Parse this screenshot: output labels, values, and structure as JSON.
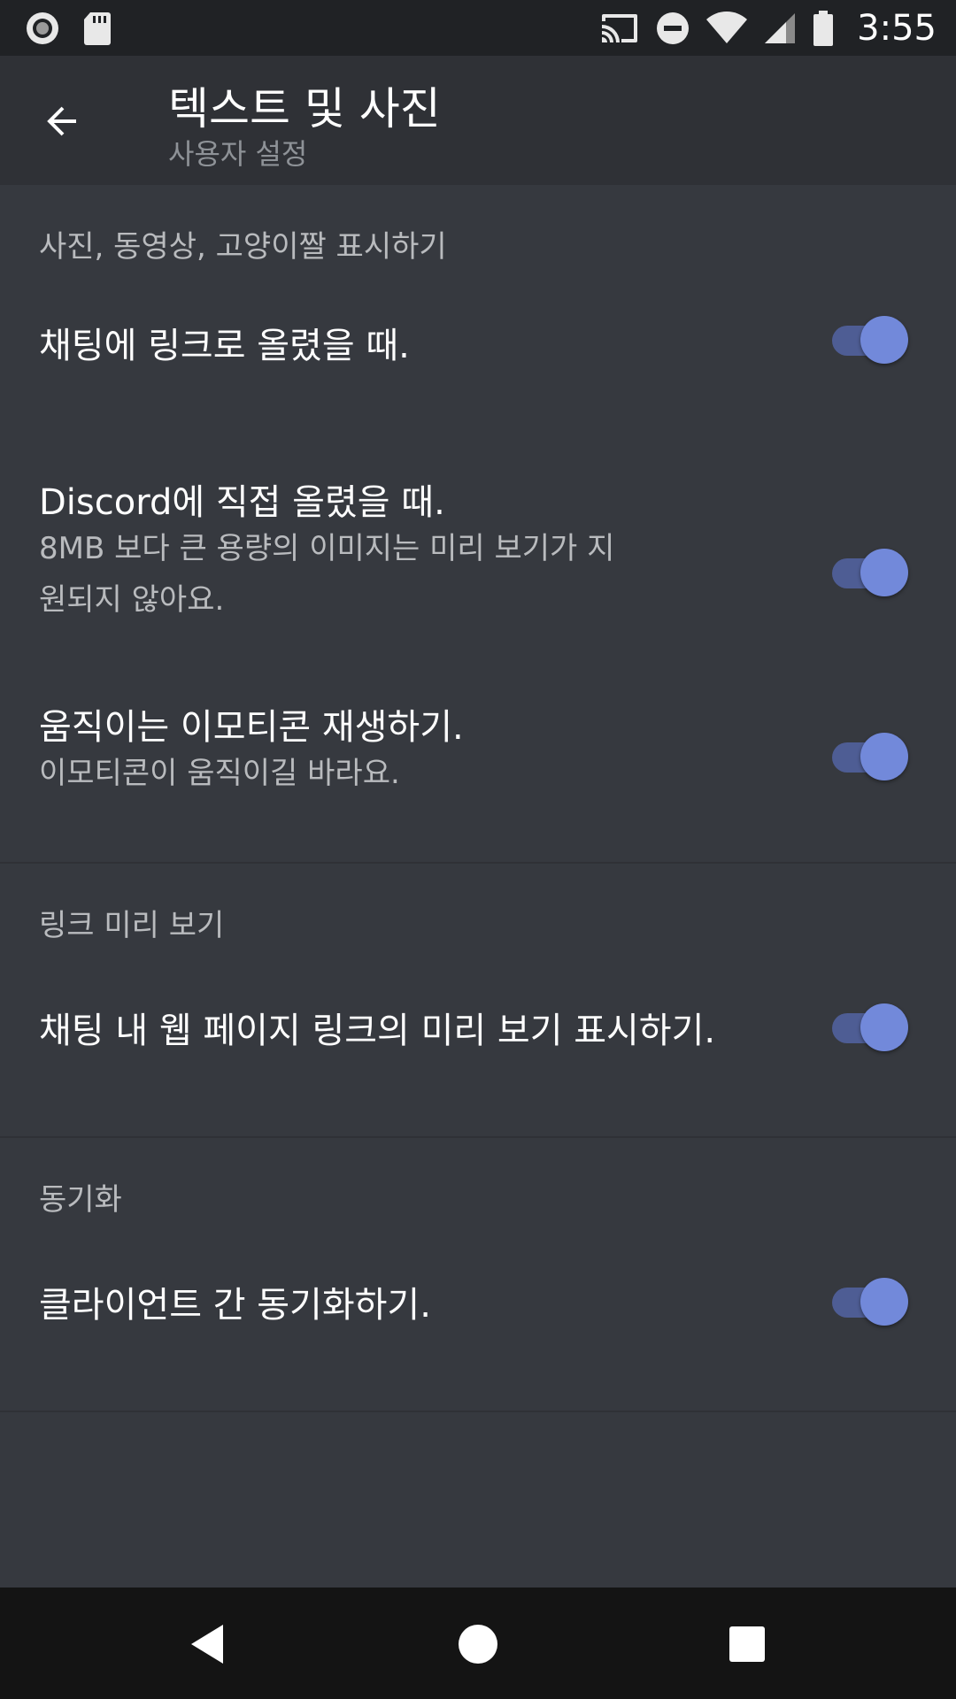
{
  "status_bar": {
    "time": "3:55",
    "icons": [
      "record-icon",
      "sd-card-icon",
      "cast-icon",
      "do-not-disturb-icon",
      "wifi-icon",
      "signal-icon",
      "battery-icon"
    ]
  },
  "app_bar": {
    "title": "텍스트 및 사진",
    "subtitle": "사용자 설정",
    "back_icon": "arrow-back-icon"
  },
  "sections": [
    {
      "header": "사진, 동영상, 고양이짤 표시하기",
      "rows": [
        {
          "title": "채팅에 링크로 올렸을 때.",
          "subtitle": "",
          "toggle_on": true
        },
        {
          "title": "Discord에 직접 올렸을 때.",
          "subtitle": "8MB 보다 큰 용량의 이미지는 미리 보기가 지원되지 않아요.",
          "toggle_on": true
        },
        {
          "title": "움직이는 이모티콘 재생하기.",
          "subtitle": "이모티콘이 움직이길 바라요.",
          "toggle_on": true
        }
      ]
    },
    {
      "header": "링크 미리 보기",
      "rows": [
        {
          "title": "채팅 내 웹 페이지 링크의 미리 보기 표시하기.",
          "subtitle": "",
          "toggle_on": true
        }
      ]
    },
    {
      "header": "동기화",
      "rows": [
        {
          "title": "클라이언트 간 동기화하기.",
          "subtitle": "",
          "toggle_on": true
        }
      ]
    }
  ],
  "colors": {
    "background": "#36393f",
    "app_bar": "#2f3136",
    "status_bar": "#202225",
    "accent": "#7289da",
    "toggle_track": "#4e5d94",
    "nav_bar": "#141414"
  },
  "nav_bar": {
    "icons": [
      "nav-back-icon",
      "nav-home-icon",
      "nav-recents-icon"
    ]
  }
}
